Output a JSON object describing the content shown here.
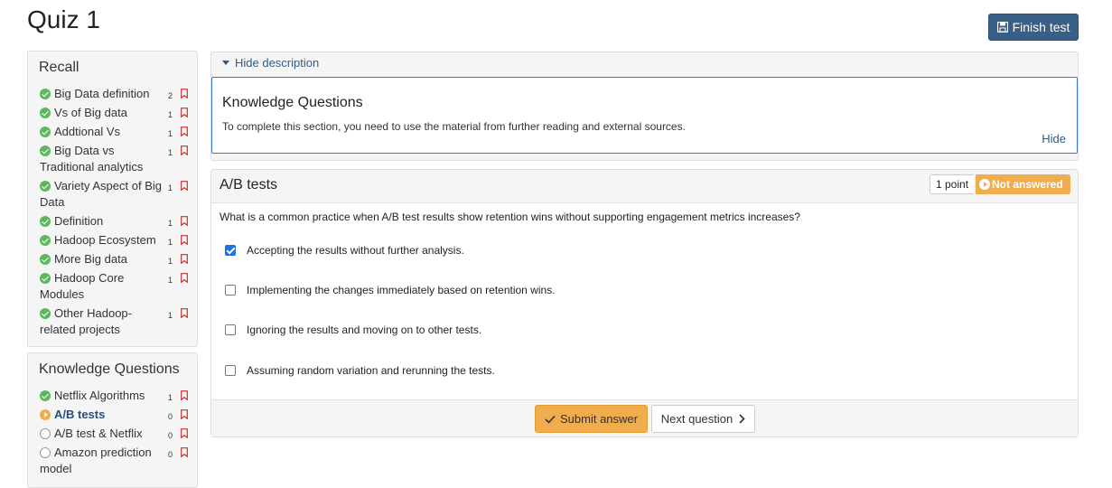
{
  "page": {
    "title": "Quiz 1"
  },
  "header": {
    "finish_label": "Finish test",
    "finish_icon": "save-icon"
  },
  "recall": {
    "heading": "Recall",
    "items": [
      {
        "label": "Big Data definition",
        "count": "2",
        "status": "done"
      },
      {
        "label": "Vs of Big data",
        "count": "1",
        "status": "done"
      },
      {
        "label": "Addtional Vs",
        "count": "1",
        "status": "done"
      },
      {
        "label": "Big Data vs Traditional analytics",
        "count": "1",
        "status": "done"
      },
      {
        "label": "Variety Aspect of Big Data",
        "count": "1",
        "status": "done"
      },
      {
        "label": "Definition",
        "count": "1",
        "status": "done"
      },
      {
        "label": "Hadoop Ecosystem",
        "count": "1",
        "status": "done"
      },
      {
        "label": "More Big data",
        "count": "1",
        "status": "done"
      },
      {
        "label": "Hadoop Core Modules",
        "count": "1",
        "status": "done"
      },
      {
        "label": "Other Hadoop-related projects",
        "count": "1",
        "status": "done"
      }
    ]
  },
  "knowledge": {
    "heading": "Knowledge Questions",
    "items": [
      {
        "label": "Netflix Algorithms",
        "count": "1",
        "status": "done"
      },
      {
        "label": "A/B tests",
        "count": "0",
        "status": "current"
      },
      {
        "label": "A/B test & Netflix",
        "count": "0",
        "status": "todo"
      },
      {
        "label": "Amazon prediction model",
        "count": "0",
        "status": "todo"
      }
    ]
  },
  "description": {
    "toggle_label": "Hide description",
    "title": "Knowledge Questions",
    "text": "To complete this section, you need to use the material from further reading and external sources.",
    "hide_label": "Hide"
  },
  "question": {
    "title": "A/B tests",
    "points": "1 point",
    "status": "Not answered",
    "text": "What is a common practice when A/B test results show retention wins without supporting engagement metrics increases?",
    "options": [
      {
        "label": "Accepting the results without further analysis.",
        "checked": true
      },
      {
        "label": "Implementing the changes immediately based on retention wins.",
        "checked": false
      },
      {
        "label": "Ignoring the results and moving on to other tests.",
        "checked": false
      },
      {
        "label": "Assuming random variation and rerunning the tests.",
        "checked": false
      }
    ],
    "submit_label": "Submit answer",
    "next_label": "Next question"
  },
  "colors": {
    "primary": "#3a5f86",
    "warning": "#f0ad4e",
    "success": "#5cb85c",
    "link": "#2a5d8f"
  }
}
